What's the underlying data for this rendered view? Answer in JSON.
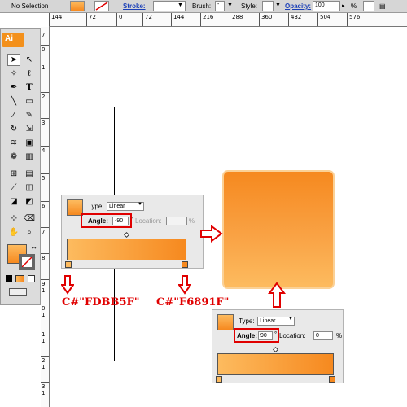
{
  "control_bar": {
    "selection": "No Selection",
    "stroke_label": "Stroke:",
    "brush_label": "Brush:",
    "brush_value": "-",
    "style_label": "Style:",
    "opacity_label": "Opacity:",
    "opacity_value": "100",
    "opacity_unit": "%"
  },
  "ruler_h": [
    "144",
    "72",
    "0",
    "72",
    "144",
    "216",
    "288",
    "360",
    "432",
    "504",
    "576"
  ],
  "ruler_v": [
    "7",
    "0",
    "1",
    "2",
    "3",
    "4",
    "5",
    "6",
    "7",
    "8",
    "9",
    "1",
    "0",
    "1",
    "1",
    "1",
    "2",
    "1",
    "3",
    "1",
    "4",
    "1",
    "5",
    "1",
    "6",
    "1",
    "7",
    "1",
    "8"
  ],
  "toolbox": {
    "logo": "Ai",
    "tools": [
      "selection",
      "direct-selection",
      "magic-wand",
      "lasso",
      "pen",
      "type",
      "line",
      "rectangle",
      "paintbrush",
      "pencil",
      "rotate",
      "scale",
      "warp",
      "free-transform",
      "symbol-sprayer",
      "graph",
      "mesh",
      "gradient",
      "eyedropper",
      "blend",
      "live-paint",
      "live-paint-select",
      "slice",
      "eraser",
      "hand",
      "zoom"
    ]
  },
  "panel_left": {
    "type_label": "Type:",
    "type_value": "Linear",
    "angle_label": "Angle:",
    "angle_value": "-90",
    "degree": "°",
    "location_label": "Location:",
    "location_value": "",
    "percent": "%"
  },
  "panel_right": {
    "type_label": "Type:",
    "type_value": "Linear",
    "angle_label": "Angle:",
    "angle_value": "90",
    "degree": "°",
    "location_label": "Location:",
    "location_value": "0",
    "percent": "%"
  },
  "colors": {
    "start_label": "C#\"FDBB5F\"",
    "end_label": "C#\"F6891F\"",
    "start": "#FDBB5F",
    "end": "#F6891F",
    "accent": "#E00000"
  }
}
